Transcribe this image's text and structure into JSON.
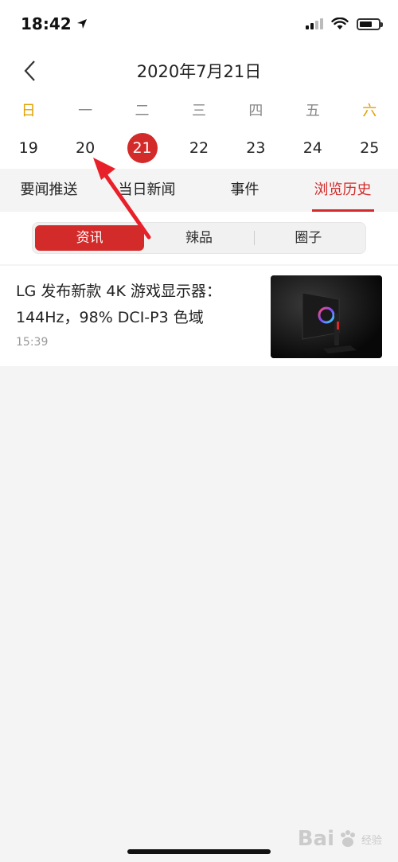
{
  "status": {
    "time": "18:42"
  },
  "nav": {
    "title": "2020年7月21日"
  },
  "calendar": {
    "weekdays": [
      "日",
      "一",
      "二",
      "三",
      "四",
      "五",
      "六"
    ],
    "days": [
      "19",
      "20",
      "21",
      "22",
      "23",
      "24",
      "25"
    ],
    "selected_day": "21"
  },
  "tabs": [
    "要闻推送",
    "当日新闻",
    "事件",
    "浏览历史"
  ],
  "active_tab": "浏览历史",
  "segments": [
    "资讯",
    "辣品",
    "圈子"
  ],
  "active_segment": "资讯",
  "news": [
    {
      "title": "LG 发布新款 4K 游戏显示器：144Hz，98% DCI-P3 色域",
      "time": "15:39"
    }
  ],
  "colors": {
    "accent": "#d32a2a",
    "weekend": "#e2a000"
  },
  "watermark": {
    "text": "Bai",
    "sub": "经验"
  }
}
